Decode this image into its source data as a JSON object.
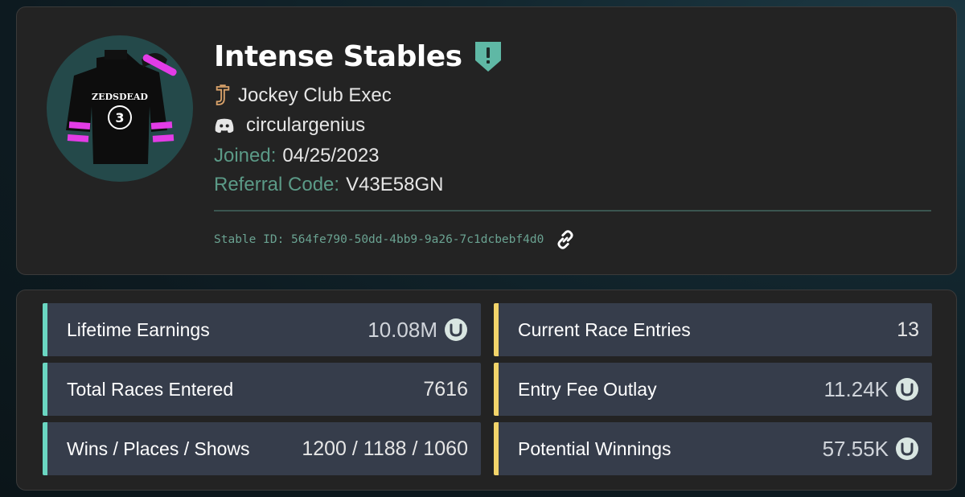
{
  "profile": {
    "stable_name": "Intense Stables",
    "badge_icon": "shield-alert-icon",
    "badge_color": "#5fb8a5",
    "role": "Jockey Club Exec",
    "discord_username": "circulargenius",
    "joined_label": "Joined:",
    "joined_value": "04/25/2023",
    "referral_label": "Referral Code:",
    "referral_value": "V43E58GN",
    "stable_id_text": "Stable ID: 564fe790-50dd-4bb9-9a26-7c1dcbebf4d0",
    "silks_text": "ZEDSDEAD"
  },
  "stats": {
    "left": [
      {
        "label": "Lifetime Earnings",
        "value": "10.08M",
        "coin": true
      },
      {
        "label": "Total Races Entered",
        "value": "7616",
        "coin": false
      },
      {
        "label": "Wins / Places / Shows",
        "value": "1200 / 1188 / 1060",
        "coin": false
      }
    ],
    "right": [
      {
        "label": "Current Race Entries",
        "value": "13",
        "coin": false
      },
      {
        "label": "Entry Fee Outlay",
        "value": "11.24K",
        "coin": true
      },
      {
        "label": "Potential Winnings",
        "value": "57.55K",
        "coin": true
      }
    ]
  },
  "colors": {
    "accent_teal": "#6ad6c1",
    "accent_gold": "#f2d46a",
    "label_green": "#5b9a87",
    "silks_pink": "#e23ce6"
  }
}
